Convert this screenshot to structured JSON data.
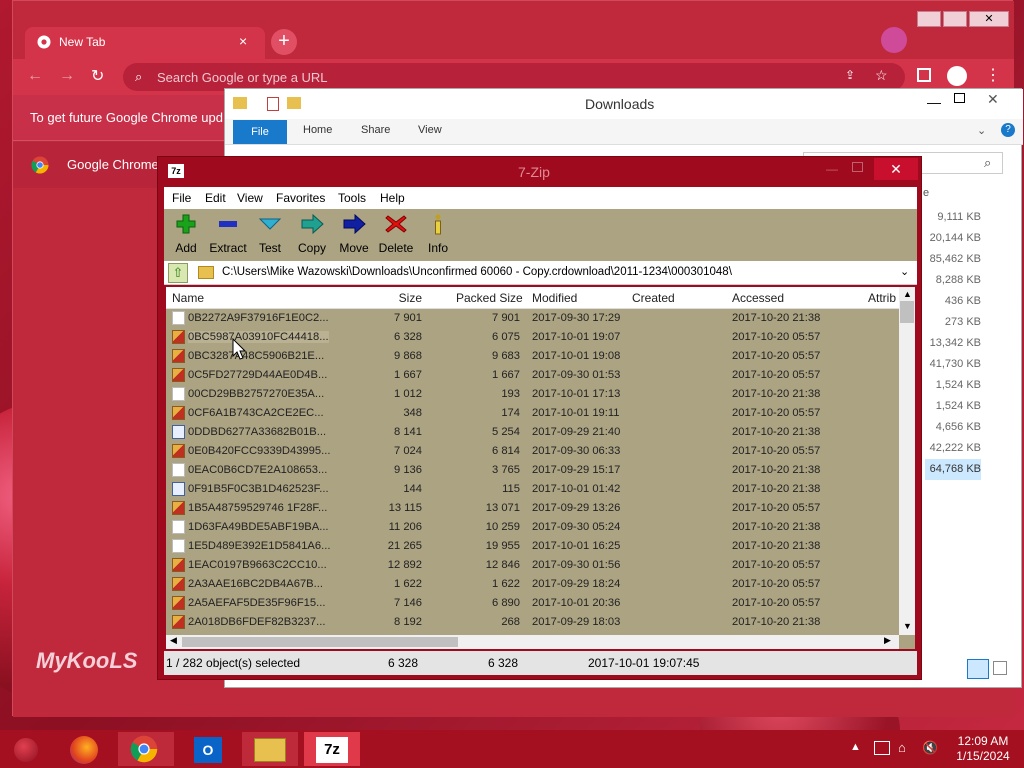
{
  "chrome": {
    "tab_title": "New Tab",
    "tab_close": "×",
    "new_tab": "+",
    "omnibox_placeholder": "Search Google or type a URL",
    "info_text": "To get future Google Chrome upd",
    "bookmark_text": "Google Chrome",
    "watermark": "MyKooLS"
  },
  "explorer": {
    "title": "Downloads",
    "ribbon_tabs": [
      "File",
      "Home",
      "Share",
      "View"
    ],
    "col_head": "e",
    "sizes": [
      "9,111 KB",
      "20,144 KB",
      "85,462 KB",
      "8,288 KB",
      "436 KB",
      "273 KB",
      "13,342 KB",
      "41,730 KB",
      "1,524 KB",
      "1,524 KB",
      "4,656 KB",
      "42,222 KB",
      "64,768 KB"
    ]
  },
  "sevenzip": {
    "title": "7-Zip",
    "close": "✕",
    "menu": [
      "File",
      "Edit",
      "View",
      "Favorites",
      "Tools",
      "Help"
    ],
    "toolbar": [
      {
        "label": "Add",
        "icon": "add-icon",
        "color": "#1aa31a"
      },
      {
        "label": "Extract",
        "icon": "extract-icon",
        "color": "#2030c0"
      },
      {
        "label": "Test",
        "icon": "test-icon",
        "color": "#30b0d0"
      },
      {
        "label": "Copy",
        "icon": "copy-icon",
        "color": "#20a090"
      },
      {
        "label": "Move",
        "icon": "move-icon",
        "color": "#1020a0"
      },
      {
        "label": "Delete",
        "icon": "delete-icon",
        "color": "#e01010"
      },
      {
        "label": "Info",
        "icon": "info-icon",
        "color": "#c0a020"
      }
    ],
    "address": "C:\\Users\\Mike Wazowski\\Downloads\\Unconfirmed 60060 - Copy.crdownload\\2011-1234\\000301048\\",
    "columns": [
      "Name",
      "Size",
      "Packed Size",
      "Modified",
      "Created",
      "Accessed",
      "Attrib"
    ],
    "rows": [
      {
        "name": "0B2272A9F37916F1E0C2...",
        "size": "7 901",
        "packed": "7 901",
        "modified": "2017-09-30 17:29",
        "accessed": "2017-10-20 21:38",
        "icon": "blank"
      },
      {
        "name": "0BC5987A03910FC44418...",
        "size": "6 328",
        "packed": "6 075",
        "modified": "2017-10-01 19:07",
        "accessed": "2017-10-20 05:57",
        "icon": "img"
      },
      {
        "name": "0BC3287A48C5906B21E...",
        "size": "9 868",
        "packed": "9 683",
        "modified": "2017-10-01 19:08",
        "accessed": "2017-10-20 05:57",
        "icon": "img"
      },
      {
        "name": "0C5FD27729D44AE0D4B...",
        "size": "1 667",
        "packed": "1 667",
        "modified": "2017-09-30 01:53",
        "accessed": "2017-10-20 05:57",
        "icon": "img"
      },
      {
        "name": "00CD29BB2757270E35A...",
        "size": "1 012",
        "packed": "193",
        "modified": "2017-10-01 17:13",
        "accessed": "2017-10-20 21:38",
        "icon": "blank"
      },
      {
        "name": "0CF6A1B743CA2CE2EC...",
        "size": "348",
        "packed": "174",
        "modified": "2017-10-01 19:11",
        "accessed": "2017-10-20 05:57",
        "icon": "img"
      },
      {
        "name": "0DDBD6277A33682B01B...",
        "size": "8 141",
        "packed": "5 254",
        "modified": "2017-09-29 21:40",
        "accessed": "2017-10-20 21:38",
        "icon": "pic"
      },
      {
        "name": "0E0B420FCC9339D43995...",
        "size": "7 024",
        "packed": "6 814",
        "modified": "2017-09-30 06:33",
        "accessed": "2017-10-20 05:57",
        "icon": "img"
      },
      {
        "name": "0EAC0B6CD7E2A108653...",
        "size": "9 136",
        "packed": "3 765",
        "modified": "2017-09-29 15:17",
        "accessed": "2017-10-20 21:38",
        "icon": "blank"
      },
      {
        "name": "0F91B5F0C3B1D462523F...",
        "size": "144",
        "packed": "115",
        "modified": "2017-10-01 01:42",
        "accessed": "2017-10-20 21:38",
        "icon": "pic"
      },
      {
        "name": "1B5A48759529746 1F28F...",
        "size": "13 115",
        "packed": "13 071",
        "modified": "2017-09-29 13:26",
        "accessed": "2017-10-20 05:57",
        "icon": "img"
      },
      {
        "name": "1D63FA49BDE5ABF19BA...",
        "size": "11 206",
        "packed": "10 259",
        "modified": "2017-09-30 05:24",
        "accessed": "2017-10-20 21:38",
        "icon": "blank"
      },
      {
        "name": "1E5D489E392E1D5841A6...",
        "size": "21 265",
        "packed": "19 955",
        "modified": "2017-10-01 16:25",
        "accessed": "2017-10-20 21:38",
        "icon": "blank"
      },
      {
        "name": "1EAC0197B9663C2CC10...",
        "size": "12 892",
        "packed": "12 846",
        "modified": "2017-09-30 01:56",
        "accessed": "2017-10-20 05:57",
        "icon": "img"
      },
      {
        "name": "2A3AAE16BC2DB4A67B...",
        "size": "1 622",
        "packed": "1 622",
        "modified": "2017-09-29 18:24",
        "accessed": "2017-10-20 05:57",
        "icon": "img"
      },
      {
        "name": "2A5AEFAF5DE35F96F15...",
        "size": "7 146",
        "packed": "6 890",
        "modified": "2017-10-01 20:36",
        "accessed": "2017-10-20 05:57",
        "icon": "img"
      },
      {
        "name": "2A018DB6FDEF82B3237...",
        "size": "8 192",
        "packed": "268",
        "modified": "2017-09-29 18:03",
        "accessed": "2017-10-20 21:38",
        "icon": "img"
      }
    ],
    "selected_row": 1,
    "status": {
      "selection": "1 / 282 object(s) selected",
      "size": "6 328",
      "packed": "6 328",
      "modified": "2017-10-01 19:07:45"
    }
  },
  "taskbar": {
    "time": "12:09 AM",
    "date": "1/15/2024",
    "apps": [
      "start-icon",
      "firefox-icon",
      "chrome-icon",
      "outlook-icon",
      "file-explorer-icon",
      "7zip-icon"
    ]
  }
}
